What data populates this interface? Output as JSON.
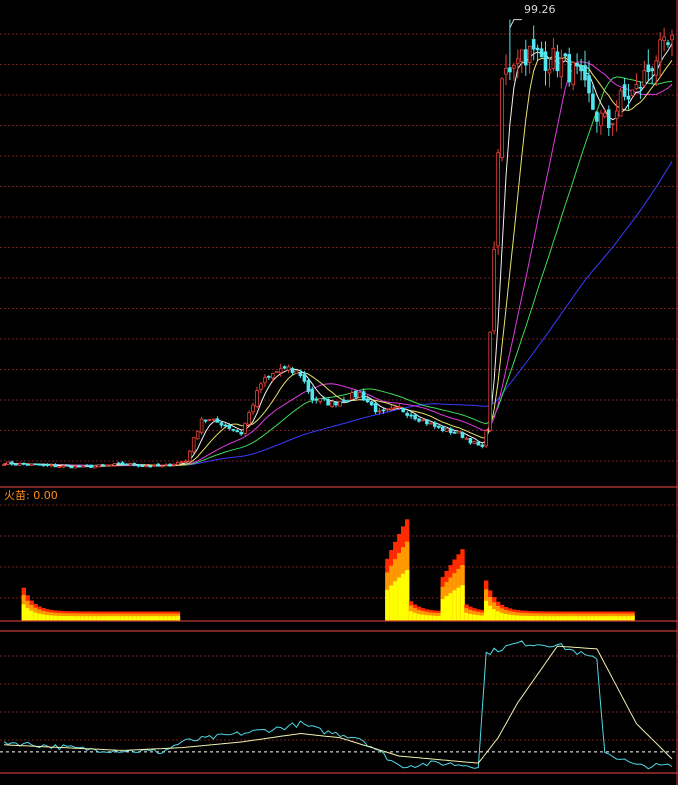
{
  "colors": {
    "background": "#000000",
    "grid": "#7a1e1e",
    "border": "#c43a3a",
    "candle_up": "#e8433a",
    "candle_down": "#54e6ee",
    "ma_white": "#f2f2f2",
    "ma_yellow": "#e7e36a",
    "ma_magenta": "#e03ce0",
    "ma_green": "#3ddc55",
    "ma_blue": "#3a3aff",
    "flame_yellow": "#ffff00",
    "flame_orange": "#ff9900",
    "flame_red": "#ff2a00",
    "osc_cyan": "#4fd9e8",
    "osc_yellow": "#f2f0b0",
    "label_orange": "#ff8c1a",
    "price_label": "#d8d8d8"
  },
  "price_panel": {
    "high_label": "99.26"
  },
  "flame_panel": {
    "title": "火苗: 0.00"
  },
  "chart_data": [
    {
      "type": "candlestick",
      "panel": "price",
      "ylim": [
        7,
        102
      ],
      "n_bars": 170,
      "max_marker": {
        "index": 128,
        "value": 99.26
      },
      "close_anchors": [
        [
          0,
          10
        ],
        [
          10,
          9.5
        ],
        [
          20,
          9.2
        ],
        [
          30,
          9.8
        ],
        [
          40,
          9.3
        ],
        [
          46,
          10.5
        ],
        [
          50,
          19
        ],
        [
          55,
          18
        ],
        [
          60,
          16
        ],
        [
          65,
          26
        ],
        [
          70,
          29
        ],
        [
          75,
          28
        ],
        [
          78,
          23
        ],
        [
          83,
          22
        ],
        [
          90,
          24
        ],
        [
          95,
          20
        ],
        [
          100,
          21
        ],
        [
          105,
          19
        ],
        [
          110,
          17
        ],
        [
          115,
          16
        ],
        [
          121,
          13
        ],
        [
          122,
          17
        ],
        [
          124,
          54
        ],
        [
          126,
          87
        ],
        [
          130,
          93
        ],
        [
          140,
          91
        ],
        [
          145,
          88
        ],
        [
          150,
          80
        ],
        [
          153,
          78
        ],
        [
          156,
          83
        ],
        [
          160,
          85
        ],
        [
          165,
          92
        ],
        [
          169,
          94
        ]
      ],
      "moving_averages": [
        {
          "color": "white",
          "period": 5
        },
        {
          "color": "yellow",
          "period": 10
        },
        {
          "color": "magenta",
          "period": 20
        },
        {
          "color": "green",
          "period": 30
        },
        {
          "color": "blue",
          "period": 60
        }
      ]
    },
    {
      "type": "bar",
      "panel": "flame",
      "ylim": [
        0,
        100
      ],
      "segments": [
        {
          "start": 5,
          "end": 44,
          "peak": 28
        },
        {
          "start": 97,
          "end": 110,
          "peak": 95
        },
        {
          "start": 111,
          "end": 121,
          "peak": 67
        },
        {
          "start": 122,
          "end": 159,
          "peak": 34
        }
      ],
      "baseline": 8
    },
    {
      "type": "line",
      "panel": "oscillator",
      "ylim": [
        0,
        100
      ],
      "dashed_level": 15,
      "series": [
        {
          "color": "cyan",
          "anchors": [
            [
              0,
              22
            ],
            [
              20,
              17
            ],
            [
              40,
              15
            ],
            [
              45,
              22
            ],
            [
              60,
              28
            ],
            [
              70,
              32
            ],
            [
              75,
              35
            ],
            [
              80,
              30
            ],
            [
              90,
              25
            ],
            [
              100,
              5
            ],
            [
              110,
              7
            ],
            [
              120,
              5
            ],
            [
              122,
              85
            ],
            [
              130,
              92
            ],
            [
              140,
              91
            ],
            [
              150,
              80
            ],
            [
              152,
              15
            ],
            [
              160,
              5
            ],
            [
              169,
              5
            ]
          ]
        },
        {
          "color": "yellow",
          "anchors": [
            [
              0,
              20
            ],
            [
              30,
              16
            ],
            [
              45,
              18
            ],
            [
              60,
              22
            ],
            [
              75,
              28
            ],
            [
              85,
              25
            ],
            [
              100,
              12
            ],
            [
              120,
              7
            ],
            [
              125,
              25
            ],
            [
              130,
              50
            ],
            [
              140,
              90
            ],
            [
              150,
              88
            ],
            [
              160,
              35
            ],
            [
              169,
              10
            ]
          ]
        }
      ]
    }
  ]
}
